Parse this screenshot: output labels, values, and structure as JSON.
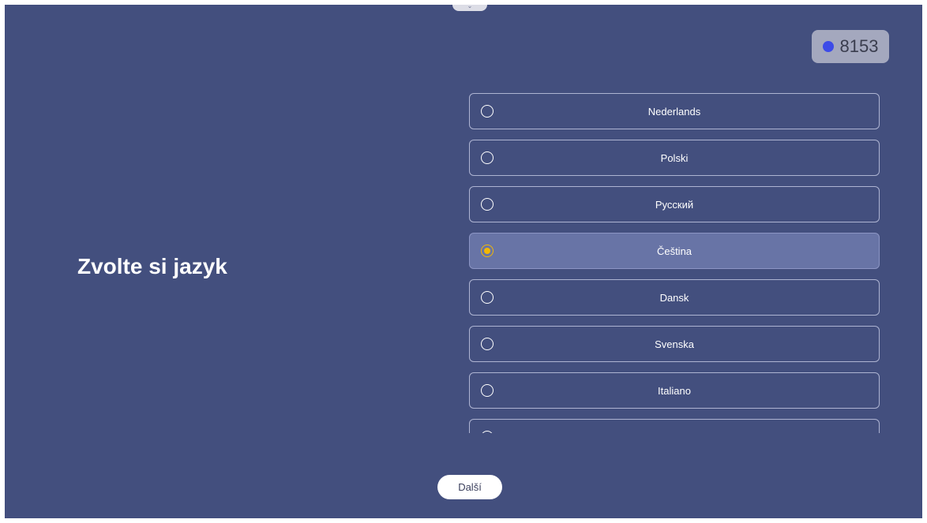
{
  "pull_tab": {
    "icon": "chevron-down-icon",
    "glyph": "⌄"
  },
  "counter": {
    "value": "8153",
    "dot_color": "#3d4be8"
  },
  "title": "Zvolte si jazyk",
  "languages": [
    {
      "label": "Nederlands",
      "selected": false
    },
    {
      "label": "Polski",
      "selected": false
    },
    {
      "label": "Русский",
      "selected": false
    },
    {
      "label": "Čeština",
      "selected": true
    },
    {
      "label": "Dansk",
      "selected": false
    },
    {
      "label": "Svenska",
      "selected": false
    },
    {
      "label": "Italiano",
      "selected": false
    },
    {
      "label": "",
      "selected": false
    }
  ],
  "next_button": {
    "label": "Další"
  },
  "colors": {
    "background": "#434f7e",
    "selected_item": "#6874a6",
    "radio_selected": "#f2b705"
  }
}
